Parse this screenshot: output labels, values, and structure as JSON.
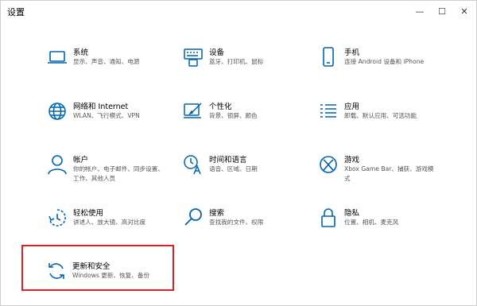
{
  "window": {
    "title": "设置",
    "controls": {
      "minimize": "—",
      "maximize": "☐",
      "close": "✕"
    }
  },
  "settings": {
    "accent_color": "#0063b1",
    "items": [
      {
        "label": "系统",
        "desc": "显示、声音、通知、电源",
        "icon": "laptop-icon"
      },
      {
        "label": "设备",
        "desc": "蓝牙、打印机、鼠标",
        "icon": "keyboard-icon"
      },
      {
        "label": "手机",
        "desc": "连接 Android 设备和 iPhone",
        "icon": "phone-icon"
      },
      {
        "label": "网络和 Internet",
        "desc": "WLAN、飞行模式、VPN",
        "icon": "globe-icon"
      },
      {
        "label": "个性化",
        "desc": "背景、锁屏、颜色",
        "icon": "paint-icon"
      },
      {
        "label": "应用",
        "desc": "卸载、默认应用、可选功能",
        "icon": "apps-list-icon"
      },
      {
        "label": "帐户",
        "desc": "你的帐户、电子邮件、同步设置、工作、其他人员",
        "icon": "person-icon"
      },
      {
        "label": "时间和语言",
        "desc": "语音、区域、日期",
        "icon": "time-language-icon"
      },
      {
        "label": "游戏",
        "desc": "Xbox Game Bar、捕获、游戏模式",
        "icon": "xbox-icon"
      },
      {
        "label": "轻松使用",
        "desc": "讲述人、放大镜、高对比度",
        "icon": "ease-of-access-icon"
      },
      {
        "label": "搜索",
        "desc": "查找我的文件、权限",
        "icon": "search-icon"
      },
      {
        "label": "隐私",
        "desc": "位置、相机、麦克风",
        "icon": "lock-icon"
      },
      {
        "label": "更新和安全",
        "desc": "Windows 更新、恢复、备份",
        "icon": "sync-icon"
      }
    ]
  },
  "highlight_color": "#e02020"
}
